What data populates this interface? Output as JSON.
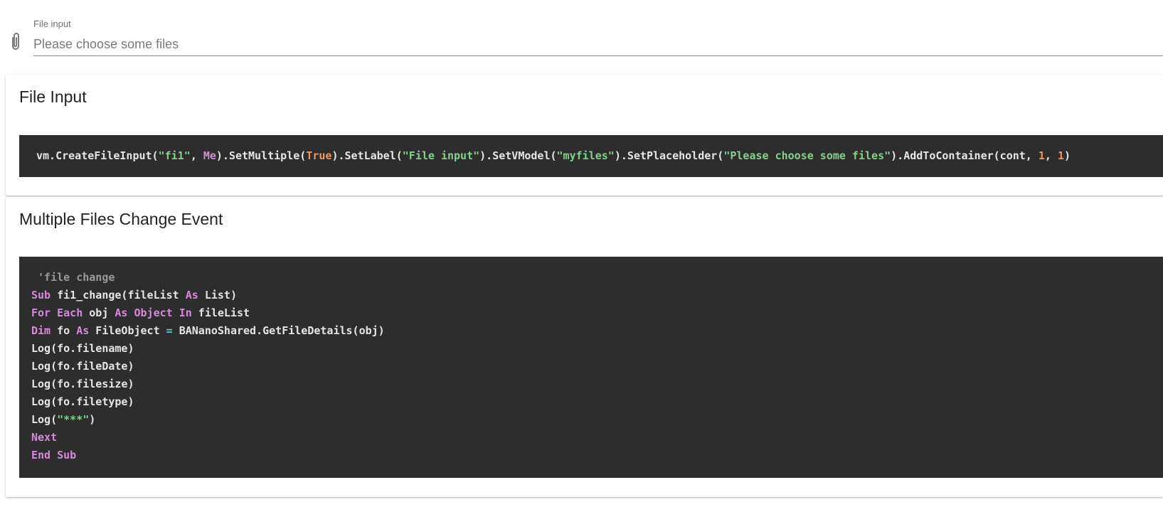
{
  "file_input": {
    "label": "File input",
    "placeholder": "Please choose some files",
    "value": "",
    "icon": "paperclip-icon"
  },
  "cards": [
    {
      "title": "File Input",
      "code_lines": [
        [
          {
            "t": "vm.CreateFileInput(",
            "k": "plain"
          },
          {
            "t": "\"fi1\"",
            "k": "string"
          },
          {
            "t": ", ",
            "k": "plain"
          },
          {
            "t": "Me",
            "k": "keyword"
          },
          {
            "t": ").SetMultiple(",
            "k": "plain"
          },
          {
            "t": "True",
            "k": "number"
          },
          {
            "t": ").SetLabel(",
            "k": "plain"
          },
          {
            "t": "\"File input\"",
            "k": "string"
          },
          {
            "t": ").SetVModel(",
            "k": "plain"
          },
          {
            "t": "\"myfiles\"",
            "k": "string"
          },
          {
            "t": ").SetPlaceholder(",
            "k": "plain"
          },
          {
            "t": "\"Please choose some files\"",
            "k": "string"
          },
          {
            "t": ").AddToContainer(cont, ",
            "k": "plain"
          },
          {
            "t": "1",
            "k": "number"
          },
          {
            "t": ", ",
            "k": "plain"
          },
          {
            "t": "1",
            "k": "number"
          },
          {
            "t": ")",
            "k": "plain"
          }
        ]
      ]
    },
    {
      "title": "Multiple Files Change Event",
      "code_lines": [
        [
          {
            "t": " 'file change",
            "k": "comment"
          }
        ],
        [
          {
            "t": "Sub",
            "k": "keyword"
          },
          {
            "t": " fi1_change(fileList ",
            "k": "plain"
          },
          {
            "t": "As",
            "k": "keyword"
          },
          {
            "t": " List)",
            "k": "plain"
          }
        ],
        [
          {
            "t": "For Each",
            "k": "keyword"
          },
          {
            "t": " obj ",
            "k": "plain"
          },
          {
            "t": "As Object In",
            "k": "keyword"
          },
          {
            "t": " fileList",
            "k": "plain"
          }
        ],
        [
          {
            "t": "Dim",
            "k": "keyword"
          },
          {
            "t": " fo ",
            "k": "plain"
          },
          {
            "t": "As",
            "k": "keyword"
          },
          {
            "t": " FileObject ",
            "k": "plain"
          },
          {
            "t": "=",
            "k": "op"
          },
          {
            "t": " BANanoShared.GetFileDetails(obj)",
            "k": "plain"
          }
        ],
        [
          {
            "t": "Log(fo.filename)",
            "k": "plain"
          }
        ],
        [
          {
            "t": "Log(fo.fileDate)",
            "k": "plain"
          }
        ],
        [
          {
            "t": "Log(fo.filesize)",
            "k": "plain"
          }
        ],
        [
          {
            "t": "Log(fo.filetype)",
            "k": "plain"
          }
        ],
        [
          {
            "t": "Log(",
            "k": "plain"
          },
          {
            "t": "\"***\"",
            "k": "string"
          },
          {
            "t": ")",
            "k": "plain"
          }
        ],
        [
          {
            "t": "Next",
            "k": "keyword"
          }
        ],
        [
          {
            "t": "End Sub",
            "k": "keyword"
          }
        ]
      ]
    }
  ],
  "colors": {
    "code_background": "#2d2d2d",
    "code_text": "#e6e6e6",
    "code_string": "#83d18a",
    "code_keyword": "#d58bd8",
    "code_number": "#f0975a",
    "code_comment": "#999999"
  }
}
